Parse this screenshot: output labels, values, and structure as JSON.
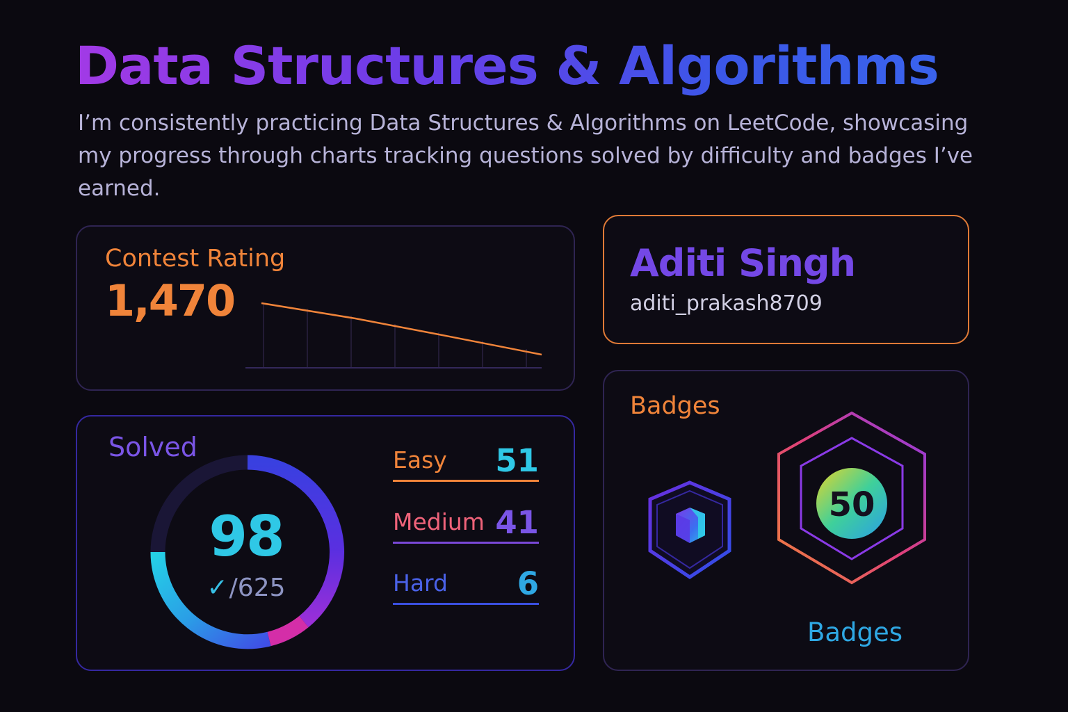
{
  "header": {
    "title": "Data Structures & Algorithms",
    "intro": "I’m consistently practicing Data Structures & Algorithms on LeetCode, showcasing my progress through charts tracking questions solved by difficulty and badges I’ve earned."
  },
  "contest": {
    "label": "Contest Rating",
    "value": "1,470"
  },
  "solved": {
    "label": "Solved",
    "count": "98",
    "total": "/625",
    "check_icon": "checkmark-icon",
    "difficulties": [
      {
        "label": "Easy",
        "count": "51",
        "label_color": "#f0843a",
        "count_color": "#2fc8e6",
        "line_color": "#f0843a"
      },
      {
        "label": "Medium",
        "count": "41",
        "label_color": "#f0637a",
        "count_color": "#7a55e6",
        "line_color": "#7a48d8"
      },
      {
        "label": "Hard",
        "count": "6",
        "label_color": "#4a62e8",
        "count_color": "#2fa8e4",
        "line_color": "#3a4fe0"
      }
    ]
  },
  "profile": {
    "name": "Aditi Singh",
    "handle": "aditi_prakash8709"
  },
  "badges": {
    "label": "Badges",
    "caption": "Badges",
    "items": [
      {
        "icon": "cube-badge-icon"
      },
      {
        "icon": "hexagon-badge-icon",
        "text": "50"
      }
    ]
  },
  "colors": {
    "accent_orange": "#f0843a",
    "accent_purple": "#7448e6",
    "accent_cyan": "#2fc8e6",
    "background": "#0b0910"
  }
}
